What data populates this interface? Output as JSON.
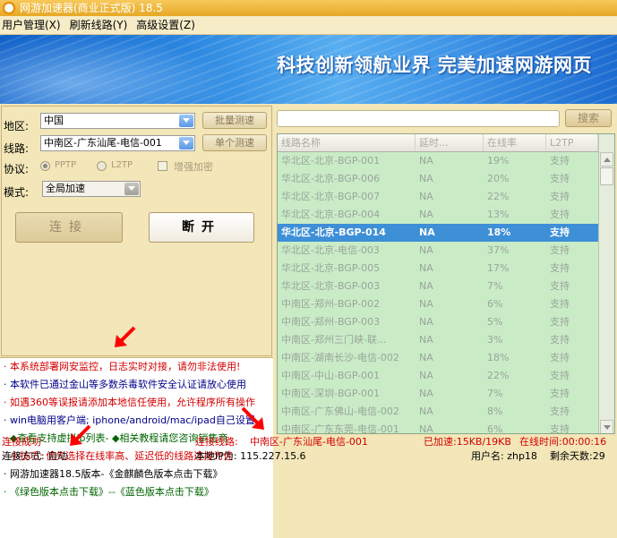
{
  "window": {
    "title": "网游加速器(商业正式版) 18.5"
  },
  "menu": [
    "用户管理(X)",
    "刷新线路(Y)",
    "高级设置(Z)"
  ],
  "banner": {
    "slogan": "科技创新领航业界 完美加速网游网页"
  },
  "form": {
    "region_label": "地区:",
    "region_value": "中国",
    "batch_test": "批量测速",
    "line_label": "线路:",
    "line_value": "中南区-广东汕尾-电信-001",
    "single_test": "单个测速",
    "protocol_label": "协议:",
    "pptp": "PPTP",
    "l2tp": "L2TP",
    "enhanced": "增强加密",
    "mode_label": "模式:",
    "mode_value": "全局加速",
    "connect": "连接",
    "disconnect": "断开"
  },
  "news": [
    {
      "text": "· 本系统部署网安监控，日志实时对接，请勿非法使用!",
      "color": "#d40000"
    },
    {
      "text": "· 本软件已通过金山等多数杀毒软件安全认证请放心使用",
      "color": "#00008b"
    },
    {
      "text": "· 如遇360等误报请添加本地信任使用，允许程序所有操作",
      "color": "#d40000"
    },
    {
      "text": "· win电脑用客户端; iphone/android/mac/ipad自己设置",
      "color": "#00008b"
    },
    {
      "text": "· ◆查看支持虚拟ip列表- ◆相关教程请您咨询销售商",
      "color": "#006400"
    },
    {
      "text": "· 小技巧: 优先选择在线率高、延迟低的线路连接为佳",
      "color": "#d40000"
    },
    {
      "text": "· 网游加速器18.5版本-《金麒麟色版本点击下载》",
      "color": "#000000"
    },
    {
      "text": "· 《绿色版本点击下载》--《蓝色版本点击下载》",
      "color": "#006400"
    }
  ],
  "search": {
    "button": "搜索"
  },
  "table": {
    "headers": [
      "线路名称",
      "延时...",
      "在线率",
      "L2TP"
    ],
    "rows": [
      [
        "华北区-北京-BGP-001",
        "NA",
        "19%",
        "支持"
      ],
      [
        "华北区-北京-BGP-006",
        "NA",
        "20%",
        "支持"
      ],
      [
        "华北区-北京-BGP-007",
        "NA",
        "22%",
        "支持"
      ],
      [
        "华北区-北京-BGP-004",
        "NA",
        "13%",
        "支持"
      ],
      [
        "华北区-北京-BGP-014",
        "NA",
        "18%",
        "支持"
      ],
      [
        "华北区-北京-电信-003",
        "NA",
        "37%",
        "支持"
      ],
      [
        "华北区-北京-BGP-005",
        "NA",
        "17%",
        "支持"
      ],
      [
        "华北区-北京-BGP-003",
        "NA",
        "7%",
        "支持"
      ],
      [
        "中南区-郑州-BGP-002",
        "NA",
        "6%",
        "支持"
      ],
      [
        "中南区-郑州-BGP-003",
        "NA",
        "5%",
        "支持"
      ],
      [
        "中南区-郑州三门峡-联...",
        "NA",
        "3%",
        "支持"
      ],
      [
        "中南区-湖南长沙-电信-002",
        "NA",
        "18%",
        "支持"
      ],
      [
        "中南区-中山-BGP-001",
        "NA",
        "22%",
        "支持"
      ],
      [
        "中南区-深圳-BGP-001",
        "NA",
        "7%",
        "支持"
      ],
      [
        "中南区-广东佛山-电信-002",
        "NA",
        "8%",
        "支持"
      ],
      [
        "中南区-广东东莞-电信-001",
        "NA",
        "6%",
        "支持"
      ]
    ],
    "selected_index": 4
  },
  "status": {
    "connected": "连接成功",
    "line_prefix": "连接线路:",
    "line_value": "中南区-广东汕尾-电信-001",
    "speed": "已加速:15KB/19KB",
    "online_time": "在线时间:00:00:16",
    "conn_method": "连接方式: 自动",
    "local_ip": "本地IP为: 115.227.15.6",
    "username": "用户名: zhp18",
    "days_left": "剩余天数:29"
  },
  "colors": {
    "accent_red": "#d40000",
    "selected_row": "#3d8fd6",
    "table_bg": "#c9ecc7"
  }
}
